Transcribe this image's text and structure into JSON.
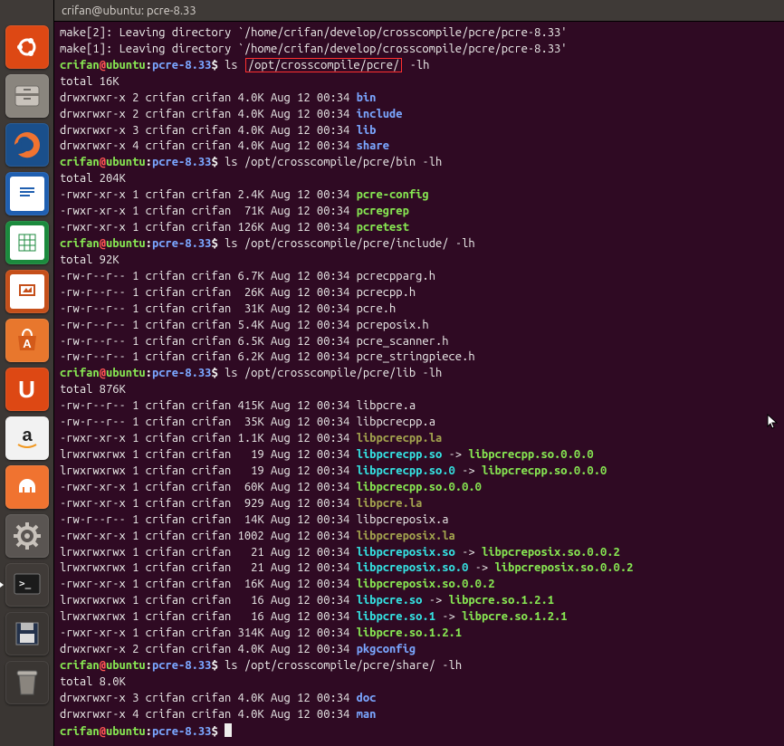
{
  "window": {
    "title": "crifan@ubuntu: pcre-8.33"
  },
  "prompt": {
    "user": "crifan",
    "at": "@",
    "host": "ubuntu",
    "colon": ":",
    "path": "pcre-8.33",
    "dollar": "$ "
  },
  "cmds": {
    "ls_root": "ls ",
    "ls_root_boxed": "/opt/crosscompile/pcre/",
    "ls_root_tail": " -lh",
    "ls_bin": "ls /opt/crosscompile/pcre/bin -lh",
    "ls_inc": "ls /opt/crosscompile/pcre/include/ -lh",
    "ls_lib": "ls /opt/crosscompile/pcre/lib -lh",
    "ls_share": "ls /opt/crosscompile/pcre/share/ -lh"
  },
  "make": {
    "l1": "make[2]: Leaving directory `/home/crifan/develop/crosscompile/pcre/pcre-8.33'",
    "l2": "make[1]: Leaving directory `/home/crifan/develop/crosscompile/pcre/pcre-8.33'"
  },
  "totals": {
    "root": "total 16K",
    "bin": "total 204K",
    "inc": "total 92K",
    "lib": "total 876K",
    "share": "total 8.0K"
  },
  "ls_root": [
    {
      "perm": "drwxrwxr-x",
      "n": "2",
      "u": "crifan",
      "g": "crifan",
      "size": "4.0K",
      "date": "Aug 12 00:34",
      "name": "bin",
      "cls": "c-blue"
    },
    {
      "perm": "drwxrwxr-x",
      "n": "2",
      "u": "crifan",
      "g": "crifan",
      "size": "4.0K",
      "date": "Aug 12 00:34",
      "name": "include",
      "cls": "c-blue"
    },
    {
      "perm": "drwxrwxr-x",
      "n": "3",
      "u": "crifan",
      "g": "crifan",
      "size": "4.0K",
      "date": "Aug 12 00:34",
      "name": "lib",
      "cls": "c-blue"
    },
    {
      "perm": "drwxrwxr-x",
      "n": "4",
      "u": "crifan",
      "g": "crifan",
      "size": "4.0K",
      "date": "Aug 12 00:34",
      "name": "share",
      "cls": "c-blue"
    }
  ],
  "ls_bin": [
    {
      "perm": "-rwxr-xr-x",
      "n": "1",
      "u": "crifan",
      "g": "crifan",
      "size": "2.4K",
      "date": "Aug 12 00:34",
      "name": "pcre-config",
      "cls": "c-green"
    },
    {
      "perm": "-rwxr-xr-x",
      "n": "1",
      "u": "crifan",
      "g": "crifan",
      "size": " 71K",
      "date": "Aug 12 00:34",
      "name": "pcregrep",
      "cls": "c-green"
    },
    {
      "perm": "-rwxr-xr-x",
      "n": "1",
      "u": "crifan",
      "g": "crifan",
      "size": "126K",
      "date": "Aug 12 00:34",
      "name": "pcretest",
      "cls": "c-green"
    }
  ],
  "ls_inc": [
    {
      "perm": "-rw-r--r--",
      "n": "1",
      "u": "crifan",
      "g": "crifan",
      "size": "6.7K",
      "date": "Aug 12 00:34",
      "name": "pcrecpparg.h",
      "cls": "c-plain"
    },
    {
      "perm": "-rw-r--r--",
      "n": "1",
      "u": "crifan",
      "g": "crifan",
      "size": " 26K",
      "date": "Aug 12 00:34",
      "name": "pcrecpp.h",
      "cls": "c-plain"
    },
    {
      "perm": "-rw-r--r--",
      "n": "1",
      "u": "crifan",
      "g": "crifan",
      "size": " 31K",
      "date": "Aug 12 00:34",
      "name": "pcre.h",
      "cls": "c-plain"
    },
    {
      "perm": "-rw-r--r--",
      "n": "1",
      "u": "crifan",
      "g": "crifan",
      "size": "5.4K",
      "date": "Aug 12 00:34",
      "name": "pcreposix.h",
      "cls": "c-plain"
    },
    {
      "perm": "-rw-r--r--",
      "n": "1",
      "u": "crifan",
      "g": "crifan",
      "size": "6.5K",
      "date": "Aug 12 00:34",
      "name": "pcre_scanner.h",
      "cls": "c-plain"
    },
    {
      "perm": "-rw-r--r--",
      "n": "1",
      "u": "crifan",
      "g": "crifan",
      "size": "6.2K",
      "date": "Aug 12 00:34",
      "name": "pcre_stringpiece.h",
      "cls": "c-plain"
    }
  ],
  "ls_lib": [
    {
      "perm": "-rw-r--r--",
      "n": "1",
      "u": "crifan",
      "g": "crifan",
      "size": "415K",
      "date": "Aug 12 00:34",
      "name": "libpcre.a",
      "cls": "c-plain"
    },
    {
      "perm": "-rw-r--r--",
      "n": "1",
      "u": "crifan",
      "g": "crifan",
      "size": " 35K",
      "date": "Aug 12 00:34",
      "name": "libpcrecpp.a",
      "cls": "c-plain"
    },
    {
      "perm": "-rwxr-xr-x",
      "n": "1",
      "u": "crifan",
      "g": "crifan",
      "size": "1.1K",
      "date": "Aug 12 00:34",
      "name": "libpcrecpp.la",
      "cls": "c-olive"
    },
    {
      "perm": "lrwxrwxrwx",
      "n": "1",
      "u": "crifan",
      "g": "crifan",
      "size": "  19",
      "date": "Aug 12 00:34",
      "name": "libpcrecpp.so",
      "cls": "c-cyan",
      "arrow": " -> ",
      "target": "libpcrecpp.so.0.0.0",
      "tcls": "c-green"
    },
    {
      "perm": "lrwxrwxrwx",
      "n": "1",
      "u": "crifan",
      "g": "crifan",
      "size": "  19",
      "date": "Aug 12 00:34",
      "name": "libpcrecpp.so.0",
      "cls": "c-cyan",
      "arrow": " -> ",
      "target": "libpcrecpp.so.0.0.0",
      "tcls": "c-green"
    },
    {
      "perm": "-rwxr-xr-x",
      "n": "1",
      "u": "crifan",
      "g": "crifan",
      "size": " 60K",
      "date": "Aug 12 00:34",
      "name": "libpcrecpp.so.0.0.0",
      "cls": "c-green"
    },
    {
      "perm": "-rwxr-xr-x",
      "n": "1",
      "u": "crifan",
      "g": "crifan",
      "size": " 929",
      "date": "Aug 12 00:34",
      "name": "libpcre.la",
      "cls": "c-olive"
    },
    {
      "perm": "-rw-r--r--",
      "n": "1",
      "u": "crifan",
      "g": "crifan",
      "size": " 14K",
      "date": "Aug 12 00:34",
      "name": "libpcreposix.a",
      "cls": "c-plain"
    },
    {
      "perm": "-rwxr-xr-x",
      "n": "1",
      "u": "crifan",
      "g": "crifan",
      "size": "1002",
      "date": "Aug 12 00:34",
      "name": "libpcreposix.la",
      "cls": "c-olive"
    },
    {
      "perm": "lrwxrwxrwx",
      "n": "1",
      "u": "crifan",
      "g": "crifan",
      "size": "  21",
      "date": "Aug 12 00:34",
      "name": "libpcreposix.so",
      "cls": "c-cyan",
      "arrow": " -> ",
      "target": "libpcreposix.so.0.0.2",
      "tcls": "c-green"
    },
    {
      "perm": "lrwxrwxrwx",
      "n": "1",
      "u": "crifan",
      "g": "crifan",
      "size": "  21",
      "date": "Aug 12 00:34",
      "name": "libpcreposix.so.0",
      "cls": "c-cyan",
      "arrow": " -> ",
      "target": "libpcreposix.so.0.0.2",
      "tcls": "c-green"
    },
    {
      "perm": "-rwxr-xr-x",
      "n": "1",
      "u": "crifan",
      "g": "crifan",
      "size": " 16K",
      "date": "Aug 12 00:34",
      "name": "libpcreposix.so.0.0.2",
      "cls": "c-green"
    },
    {
      "perm": "lrwxrwxrwx",
      "n": "1",
      "u": "crifan",
      "g": "crifan",
      "size": "  16",
      "date": "Aug 12 00:34",
      "name": "libpcre.so",
      "cls": "c-cyan",
      "arrow": " -> ",
      "target": "libpcre.so.1.2.1",
      "tcls": "c-green"
    },
    {
      "perm": "lrwxrwxrwx",
      "n": "1",
      "u": "crifan",
      "g": "crifan",
      "size": "  16",
      "date": "Aug 12 00:34",
      "name": "libpcre.so.1",
      "cls": "c-cyan",
      "arrow": " -> ",
      "target": "libpcre.so.1.2.1",
      "tcls": "c-green"
    },
    {
      "perm": "-rwxr-xr-x",
      "n": "1",
      "u": "crifan",
      "g": "crifan",
      "size": "314K",
      "date": "Aug 12 00:34",
      "name": "libpcre.so.1.2.1",
      "cls": "c-green"
    },
    {
      "perm": "drwxrwxr-x",
      "n": "2",
      "u": "crifan",
      "g": "crifan",
      "size": "4.0K",
      "date": "Aug 12 00:34",
      "name": "pkgconfig",
      "cls": "c-blue"
    }
  ],
  "ls_share": [
    {
      "perm": "drwxrwxr-x",
      "n": "3",
      "u": "crifan",
      "g": "crifan",
      "size": "4.0K",
      "date": "Aug 12 00:34",
      "name": "doc",
      "cls": "c-blue"
    },
    {
      "perm": "drwxrwxr-x",
      "n": "4",
      "u": "crifan",
      "g": "crifan",
      "size": "4.0K",
      "date": "Aug 12 00:34",
      "name": "man",
      "cls": "c-blue"
    }
  ],
  "launcher": [
    {
      "id": "dash",
      "title": "Dash Home",
      "bg": "#dd4814",
      "glyph": "ubuntu"
    },
    {
      "id": "files",
      "title": "Files",
      "bg": "#8a857e",
      "glyph": "drawer"
    },
    {
      "id": "firefox",
      "title": "Firefox",
      "bg": "#1a4f8b",
      "glyph": "firefox"
    },
    {
      "id": "writer",
      "title": "LibreOffice Writer",
      "bg": "#1f5fb0",
      "glyph": "doc"
    },
    {
      "id": "calc",
      "title": "LibreOffice Calc",
      "bg": "#1b8a3d",
      "glyph": "sheet"
    },
    {
      "id": "impress",
      "title": "LibreOffice Impress",
      "bg": "#c54f1a",
      "glyph": "slides"
    },
    {
      "id": "software",
      "title": "Ubuntu Software Center",
      "bg": "#e8772d",
      "glyph": "bag"
    },
    {
      "id": "ubuntuone",
      "title": "Ubuntu One",
      "bg": "#dd4814",
      "glyph": "U1"
    },
    {
      "id": "amazon",
      "title": "Amazon",
      "bg": "#f2f2f2",
      "glyph": "a"
    },
    {
      "id": "music",
      "title": "Ubuntu One Music",
      "bg": "#f07330",
      "glyph": "head"
    },
    {
      "id": "settings",
      "title": "System Settings",
      "bg": "#5a5552",
      "glyph": "gear"
    },
    {
      "id": "terminal",
      "title": "Terminal",
      "bg": "#403b38",
      "glyph": "term",
      "active": true
    },
    {
      "id": "disk",
      "title": "Save / Floppy",
      "bg": "#3a3633",
      "glyph": "floppy"
    },
    {
      "id": "trash",
      "title": "Trash",
      "bg": "#3a3633",
      "glyph": "trash"
    }
  ]
}
